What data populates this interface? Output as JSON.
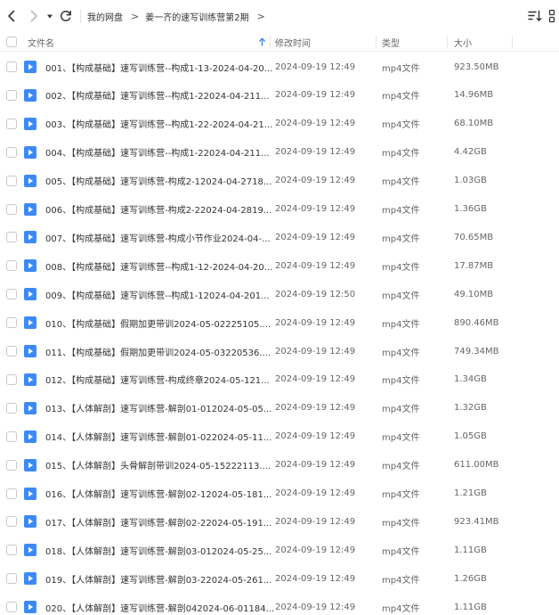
{
  "toolbar": {
    "breadcrumb": [
      "我的网盘",
      "姜一齐的速写训练营第2期"
    ],
    "separator": ">"
  },
  "table": {
    "headers": {
      "name": "文件名",
      "modified": "修改时间",
      "type": "类型",
      "size": "大小"
    },
    "rows": [
      {
        "name": "001、【构成基础】速写训练营--构成1-13-2024-04-20...",
        "modified": "2024-09-19 12:49",
        "type": "mp4文件",
        "size": "923.50MB"
      },
      {
        "name": "002、【构成基础】速写训练营--构成1-22024-04-211...",
        "modified": "2024-09-19 12:49",
        "type": "mp4文件",
        "size": "14.96MB"
      },
      {
        "name": "003、【构成基础】速写训练营--构成1-22-2024-04-21...",
        "modified": "2024-09-19 12:49",
        "type": "mp4文件",
        "size": "68.10MB"
      },
      {
        "name": "004、【构成基础】速写训练营--构成1-22024-04-211...",
        "modified": "2024-09-19 12:49",
        "type": "mp4文件",
        "size": "4.42GB"
      },
      {
        "name": "005、【构成基础】速写训练营-构成2-12024-04-2718...",
        "modified": "2024-09-19 12:49",
        "type": "mp4文件",
        "size": "1.03GB"
      },
      {
        "name": "006、【构成基础】速写训练营-构成2-22024-04-2819...",
        "modified": "2024-09-19 12:49",
        "type": "mp4文件",
        "size": "1.36GB"
      },
      {
        "name": "007、【构成基础】速写训练营-构成小节作业2024-04-...",
        "modified": "2024-09-19 12:49",
        "type": "mp4文件",
        "size": "70.65MB"
      },
      {
        "name": "008、【构成基础】速写训练营--构成1-12-2024-04-20...",
        "modified": "2024-09-19 12:49",
        "type": "mp4文件",
        "size": "17.87MB"
      },
      {
        "name": "009、【构成基础】速写训练营--构成1-12024-04-201...",
        "modified": "2024-09-19 12:50",
        "type": "mp4文件",
        "size": "49.10MB"
      },
      {
        "name": "010、【构成基础】假期加更带训2024-05-02225105....",
        "modified": "2024-09-19 12:49",
        "type": "mp4文件",
        "size": "890.46MB"
      },
      {
        "name": "011、【构成基础】假期加更带训2024-05-03220536....",
        "modified": "2024-09-19 12:49",
        "type": "mp4文件",
        "size": "749.34MB"
      },
      {
        "name": "012、【构成基础】速写训练营-构成终章2024-05-121...",
        "modified": "2024-09-19 12:49",
        "type": "mp4文件",
        "size": "1.34GB"
      },
      {
        "name": "013、【人体解剖】速写训练营-解剖01-012024-05-05...",
        "modified": "2024-09-19 12:49",
        "type": "mp4文件",
        "size": "1.32GB"
      },
      {
        "name": "014、【人体解剖】速写训练营-解剖01-022024-05-11...",
        "modified": "2024-09-19 12:49",
        "type": "mp4文件",
        "size": "1.05GB"
      },
      {
        "name": "015、【人体解剖】头骨解剖带训2024-05-15222113....",
        "modified": "2024-09-19 12:49",
        "type": "mp4文件",
        "size": "611.00MB"
      },
      {
        "name": "016、【人体解剖】速写训练营-解剖02-12024-05-181...",
        "modified": "2024-09-19 12:49",
        "type": "mp4文件",
        "size": "1.21GB"
      },
      {
        "name": "017、【人体解剖】速写训练营-解剖02-22024-05-191...",
        "modified": "2024-09-19 12:49",
        "type": "mp4文件",
        "size": "923.41MB"
      },
      {
        "name": "018、【人体解剖】速写训练营-解剖03-012024-05-25...",
        "modified": "2024-09-19 12:49",
        "type": "mp4文件",
        "size": "1.11GB"
      },
      {
        "name": "019、【人体解剖】速写训练营-解剖03-22024-05-261...",
        "modified": "2024-09-19 12:49",
        "type": "mp4文件",
        "size": "1.26GB"
      },
      {
        "name": "020、【人体解剖】速写训练营-解剖042024-06-01184...",
        "modified": "2024-09-19 12:49",
        "type": "mp4文件",
        "size": "1.11GB"
      }
    ]
  },
  "icons": {
    "back": "chevron-left-icon",
    "forward": "chevron-right-icon",
    "history_dropdown": "caret-down-icon",
    "refresh": "refresh-icon",
    "sort": "sort-icon",
    "more": "more-icon",
    "file": "video-file-icon",
    "sort_direction": "arrow-up-icon"
  },
  "colors": {
    "accent": "#3d8af7",
    "file_icon": "#3d8af7"
  }
}
